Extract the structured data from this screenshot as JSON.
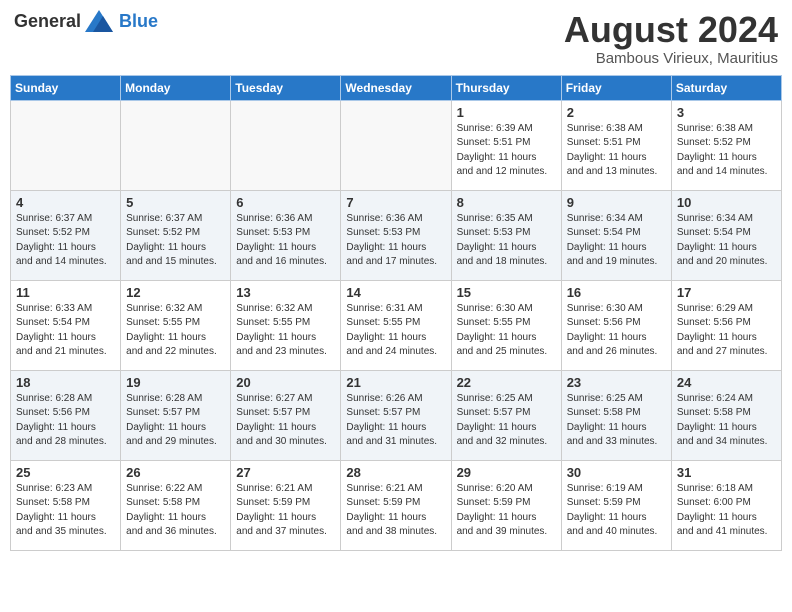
{
  "header": {
    "logo_general": "General",
    "logo_blue": "Blue",
    "month_year": "August 2024",
    "location": "Bambous Virieux, Mauritius"
  },
  "days_of_week": [
    "Sunday",
    "Monday",
    "Tuesday",
    "Wednesday",
    "Thursday",
    "Friday",
    "Saturday"
  ],
  "weeks": [
    [
      {
        "day": "",
        "info": ""
      },
      {
        "day": "",
        "info": ""
      },
      {
        "day": "",
        "info": ""
      },
      {
        "day": "",
        "info": ""
      },
      {
        "day": "1",
        "info": "Sunrise: 6:39 AM\nSunset: 5:51 PM\nDaylight: 11 hours and 12 minutes."
      },
      {
        "day": "2",
        "info": "Sunrise: 6:38 AM\nSunset: 5:51 PM\nDaylight: 11 hours and 13 minutes."
      },
      {
        "day": "3",
        "info": "Sunrise: 6:38 AM\nSunset: 5:52 PM\nDaylight: 11 hours and 14 minutes."
      }
    ],
    [
      {
        "day": "4",
        "info": "Sunrise: 6:37 AM\nSunset: 5:52 PM\nDaylight: 11 hours and 14 minutes."
      },
      {
        "day": "5",
        "info": "Sunrise: 6:37 AM\nSunset: 5:52 PM\nDaylight: 11 hours and 15 minutes."
      },
      {
        "day": "6",
        "info": "Sunrise: 6:36 AM\nSunset: 5:53 PM\nDaylight: 11 hours and 16 minutes."
      },
      {
        "day": "7",
        "info": "Sunrise: 6:36 AM\nSunset: 5:53 PM\nDaylight: 11 hours and 17 minutes."
      },
      {
        "day": "8",
        "info": "Sunrise: 6:35 AM\nSunset: 5:53 PM\nDaylight: 11 hours and 18 minutes."
      },
      {
        "day": "9",
        "info": "Sunrise: 6:34 AM\nSunset: 5:54 PM\nDaylight: 11 hours and 19 minutes."
      },
      {
        "day": "10",
        "info": "Sunrise: 6:34 AM\nSunset: 5:54 PM\nDaylight: 11 hours and 20 minutes."
      }
    ],
    [
      {
        "day": "11",
        "info": "Sunrise: 6:33 AM\nSunset: 5:54 PM\nDaylight: 11 hours and 21 minutes."
      },
      {
        "day": "12",
        "info": "Sunrise: 6:32 AM\nSunset: 5:55 PM\nDaylight: 11 hours and 22 minutes."
      },
      {
        "day": "13",
        "info": "Sunrise: 6:32 AM\nSunset: 5:55 PM\nDaylight: 11 hours and 23 minutes."
      },
      {
        "day": "14",
        "info": "Sunrise: 6:31 AM\nSunset: 5:55 PM\nDaylight: 11 hours and 24 minutes."
      },
      {
        "day": "15",
        "info": "Sunrise: 6:30 AM\nSunset: 5:55 PM\nDaylight: 11 hours and 25 minutes."
      },
      {
        "day": "16",
        "info": "Sunrise: 6:30 AM\nSunset: 5:56 PM\nDaylight: 11 hours and 26 minutes."
      },
      {
        "day": "17",
        "info": "Sunrise: 6:29 AM\nSunset: 5:56 PM\nDaylight: 11 hours and 27 minutes."
      }
    ],
    [
      {
        "day": "18",
        "info": "Sunrise: 6:28 AM\nSunset: 5:56 PM\nDaylight: 11 hours and 28 minutes."
      },
      {
        "day": "19",
        "info": "Sunrise: 6:28 AM\nSunset: 5:57 PM\nDaylight: 11 hours and 29 minutes."
      },
      {
        "day": "20",
        "info": "Sunrise: 6:27 AM\nSunset: 5:57 PM\nDaylight: 11 hours and 30 minutes."
      },
      {
        "day": "21",
        "info": "Sunrise: 6:26 AM\nSunset: 5:57 PM\nDaylight: 11 hours and 31 minutes."
      },
      {
        "day": "22",
        "info": "Sunrise: 6:25 AM\nSunset: 5:57 PM\nDaylight: 11 hours and 32 minutes."
      },
      {
        "day": "23",
        "info": "Sunrise: 6:25 AM\nSunset: 5:58 PM\nDaylight: 11 hours and 33 minutes."
      },
      {
        "day": "24",
        "info": "Sunrise: 6:24 AM\nSunset: 5:58 PM\nDaylight: 11 hours and 34 minutes."
      }
    ],
    [
      {
        "day": "25",
        "info": "Sunrise: 6:23 AM\nSunset: 5:58 PM\nDaylight: 11 hours and 35 minutes."
      },
      {
        "day": "26",
        "info": "Sunrise: 6:22 AM\nSunset: 5:58 PM\nDaylight: 11 hours and 36 minutes."
      },
      {
        "day": "27",
        "info": "Sunrise: 6:21 AM\nSunset: 5:59 PM\nDaylight: 11 hours and 37 minutes."
      },
      {
        "day": "28",
        "info": "Sunrise: 6:21 AM\nSunset: 5:59 PM\nDaylight: 11 hours and 38 minutes."
      },
      {
        "day": "29",
        "info": "Sunrise: 6:20 AM\nSunset: 5:59 PM\nDaylight: 11 hours and 39 minutes."
      },
      {
        "day": "30",
        "info": "Sunrise: 6:19 AM\nSunset: 5:59 PM\nDaylight: 11 hours and 40 minutes."
      },
      {
        "day": "31",
        "info": "Sunrise: 6:18 AM\nSunset: 6:00 PM\nDaylight: 11 hours and 41 minutes."
      }
    ]
  ]
}
